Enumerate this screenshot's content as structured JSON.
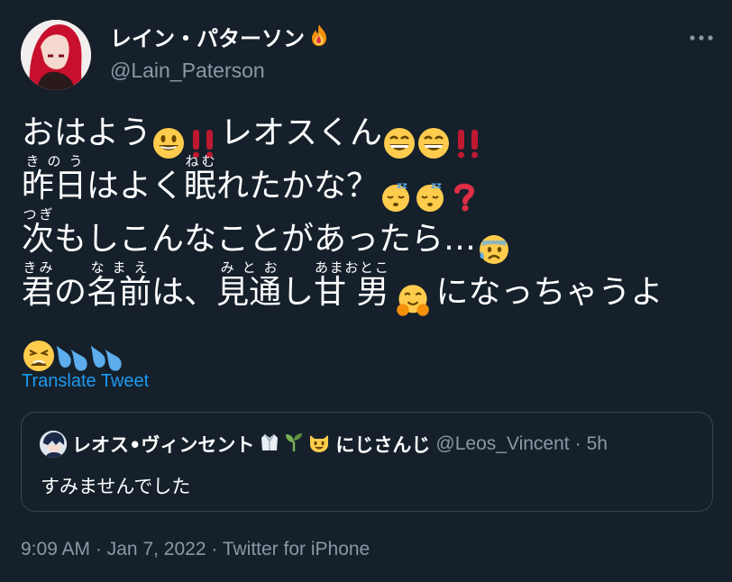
{
  "author": {
    "display_name": "レイン・パターソン",
    "handle": "@Lain_Paterson",
    "name_emoji": "fire-icon"
  },
  "more_icon": "more-options-icon",
  "tweet_lines": [
    [
      "おはよう",
      "😃",
      "‼",
      "レオスくん",
      "😄",
      "😄",
      "‼"
    ],
    [
      "昨日",
      "はよく",
      "眠",
      "れたかな？",
      "😴",
      "😴",
      "❓"
    ],
    [
      "次",
      "もしこんなことがあったら…",
      "😰"
    ],
    [
      "君",
      "の",
      "名前",
      "は、",
      "見通",
      "し",
      "甘男",
      "🤗",
      "になっちゃうよ"
    ],
    [
      "😩",
      "💦",
      "💦"
    ]
  ],
  "ruby": {
    "kinou": {
      "base": "昨日",
      "reading": "きのう"
    },
    "nemu": {
      "base": "眠",
      "reading": "ねむ"
    },
    "tsugi": {
      "base": "次",
      "reading": "つぎ"
    },
    "kimi": {
      "base": "君",
      "reading": "きみ"
    },
    "namae": {
      "base": "名前",
      "reading": "なまえ"
    },
    "mitoo": {
      "base": "見通",
      "reading": "みとお"
    },
    "amaotoko": {
      "base": "甘 男",
      "reading": "あまおとこ"
    }
  },
  "text": {
    "l1_a": "おはよう",
    "l1_b": "レオスくん",
    "l2_a": "はよく",
    "l2_b": "れたかな？",
    "l3_a": "もしこんなことがあったら…",
    "l4_a": "の",
    "l4_b": "は、",
    "l4_c": "し",
    "l4_d": "になっちゃうよ"
  },
  "translate_label": "Translate Tweet",
  "quote": {
    "display_name": "レオス•ヴィンセント",
    "name_suffix": "にじさんじ",
    "handle": "@Leos_Vincent",
    "separator": "·",
    "time": "5h",
    "text": "すみませんでした"
  },
  "meta": {
    "time": "9:09 AM",
    "sep1": "·",
    "date": "Jan 7, 2022",
    "sep2": "·",
    "source": "Twitter for iPhone"
  },
  "colors": {
    "background": "#15202b",
    "secondary_text": "#8b98a5",
    "accent": "#1d9bf0",
    "border": "#38444d"
  }
}
